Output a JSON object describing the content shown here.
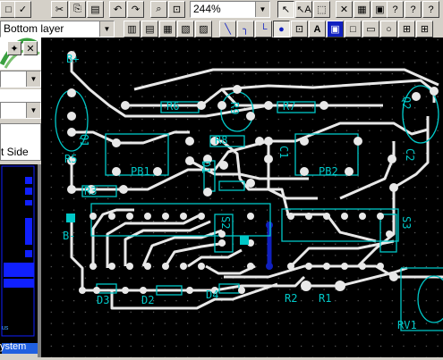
{
  "toolbar1": {
    "zoom_value": "244%"
  },
  "toolbar2": {
    "layer_value": "Bottom layer"
  },
  "left_panel": {
    "side_label": "t Side",
    "status_text": "ystem",
    "misc_text": "us"
  },
  "board": {
    "labels": {
      "b_plus": "B+",
      "b_minus": "B-",
      "q1": "Q1",
      "q2": "Q2",
      "r5": "R5",
      "r3": "R3",
      "r6": "R6",
      "r7": "R7",
      "r8": "R8",
      "r9": "R9",
      "pb1": "PB1",
      "pb2": "PB2",
      "d1": "D1",
      "c1": "C1",
      "c2": "C2",
      "d3": "D3",
      "d2": "D2",
      "d4": "D4",
      "r2": "R2",
      "r1": "R1",
      "rv1": "RV1",
      "s2": "S2",
      "s3": "S3"
    }
  },
  "colors": {
    "board_bg": "#000000",
    "copper": "#e8e8e8",
    "silkscreen": "#00c8c8",
    "selected_trace": "#1020c0"
  }
}
